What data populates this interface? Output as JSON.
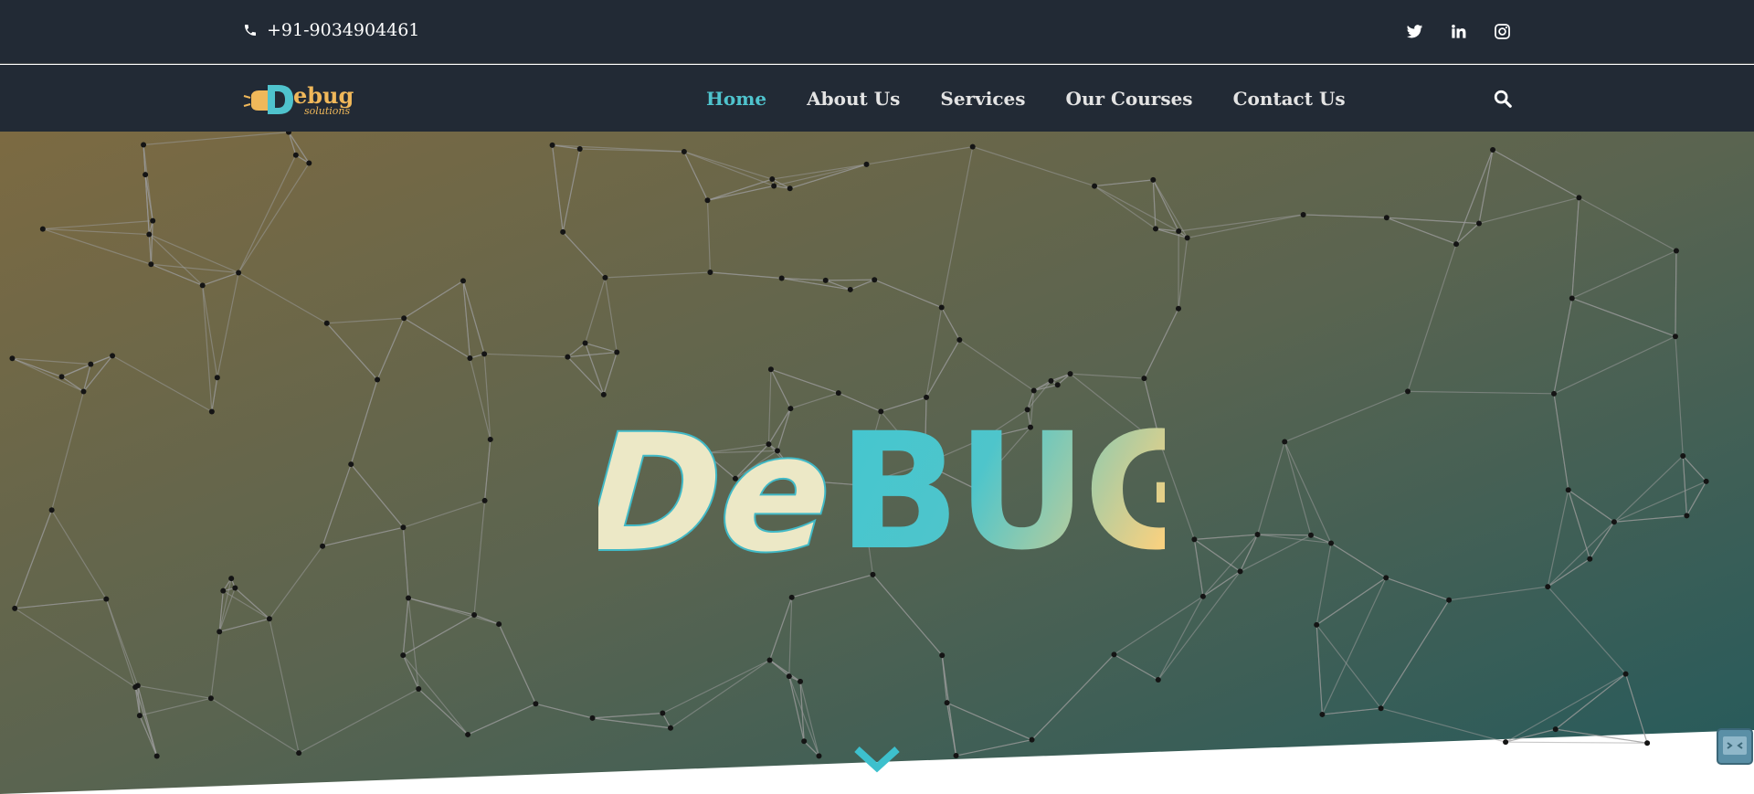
{
  "topbar": {
    "phone": "+91-9034904461",
    "phone_icon": "phone-icon",
    "social_icons": [
      "twitter-icon",
      "linkedin-icon",
      "instagram-icon"
    ]
  },
  "brand": {
    "logo_main": "Debug",
    "logo_sub": "solutions"
  },
  "nav": {
    "items": [
      {
        "label": "Home",
        "active": true
      },
      {
        "label": "About Us",
        "active": false
      },
      {
        "label": "Services",
        "active": false
      },
      {
        "label": "Our Courses",
        "active": false
      },
      {
        "label": "Contact Us",
        "active": false
      }
    ],
    "search_icon": "search-icon"
  },
  "hero": {
    "title_part1": "De",
    "title_part2": "BUG"
  },
  "colors": {
    "header_bg": "#222a35",
    "accent": "#4fc3cd",
    "logo_gold": "#f0b85a",
    "gradient_start": "#7c6a42",
    "gradient_end": "#245a5c",
    "title_cream": "#ece8c6"
  }
}
